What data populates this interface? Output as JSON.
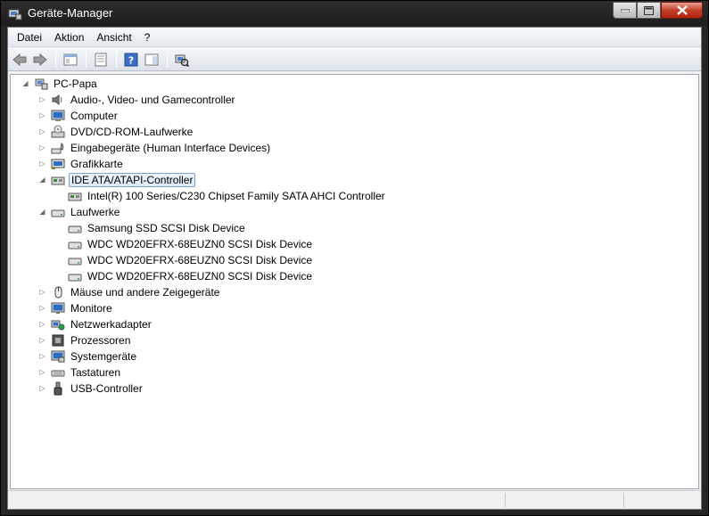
{
  "window": {
    "title": "Geräte-Manager"
  },
  "menu": [
    "Datei",
    "Aktion",
    "Ansicht",
    "?"
  ],
  "toolbar": {
    "buttons": [
      "back-icon",
      "forward-icon",
      "show-hide-console-tree-icon",
      "properties-icon",
      "help-icon",
      "action-pane-icon",
      "scan-hardware-icon"
    ]
  },
  "tree": {
    "root": "PC-Papa",
    "categories": [
      {
        "label": "Audio-, Video- und Gamecontroller",
        "icon": "speaker-icon",
        "expanded": false
      },
      {
        "label": "Computer",
        "icon": "computer-icon",
        "expanded": false
      },
      {
        "label": "DVD/CD-ROM-Laufwerke",
        "icon": "dvd-drive-icon",
        "expanded": false
      },
      {
        "label": "Eingabegeräte (Human Interface Devices)",
        "icon": "hid-icon",
        "expanded": false
      },
      {
        "label": "Grafikkarte",
        "icon": "display-adapter-icon",
        "expanded": false
      },
      {
        "label": "IDE ATA/ATAPI-Controller",
        "icon": "ide-controller-icon",
        "expanded": true,
        "selected": true,
        "children": [
          "Intel(R) 100 Series/C230 Chipset Family SATA AHCI Controller"
        ]
      },
      {
        "label": "Laufwerke",
        "icon": "disk-drive-icon",
        "expanded": true,
        "children": [
          "Samsung SSD SCSI Disk Device",
          "WDC WD20EFRX-68EUZN0 SCSI Disk Device",
          "WDC WD20EFRX-68EUZN0 SCSI Disk Device",
          "WDC WD20EFRX-68EUZN0 SCSI Disk Device"
        ]
      },
      {
        "label": "Mäuse und andere Zeigegeräte",
        "icon": "mouse-icon",
        "expanded": false
      },
      {
        "label": "Monitore",
        "icon": "monitor-icon",
        "expanded": false
      },
      {
        "label": "Netzwerkadapter",
        "icon": "network-adapter-icon",
        "expanded": false
      },
      {
        "label": "Prozessoren",
        "icon": "processor-icon",
        "expanded": false
      },
      {
        "label": "Systemgeräte",
        "icon": "system-devices-icon",
        "expanded": false
      },
      {
        "label": "Tastaturen",
        "icon": "keyboard-icon",
        "expanded": false
      },
      {
        "label": "USB-Controller",
        "icon": "usb-icon",
        "expanded": false
      }
    ]
  },
  "colors": {
    "selection_border": "#7da2ce",
    "selection_fill": "#dce9f8",
    "close_button": "#c4402a"
  }
}
